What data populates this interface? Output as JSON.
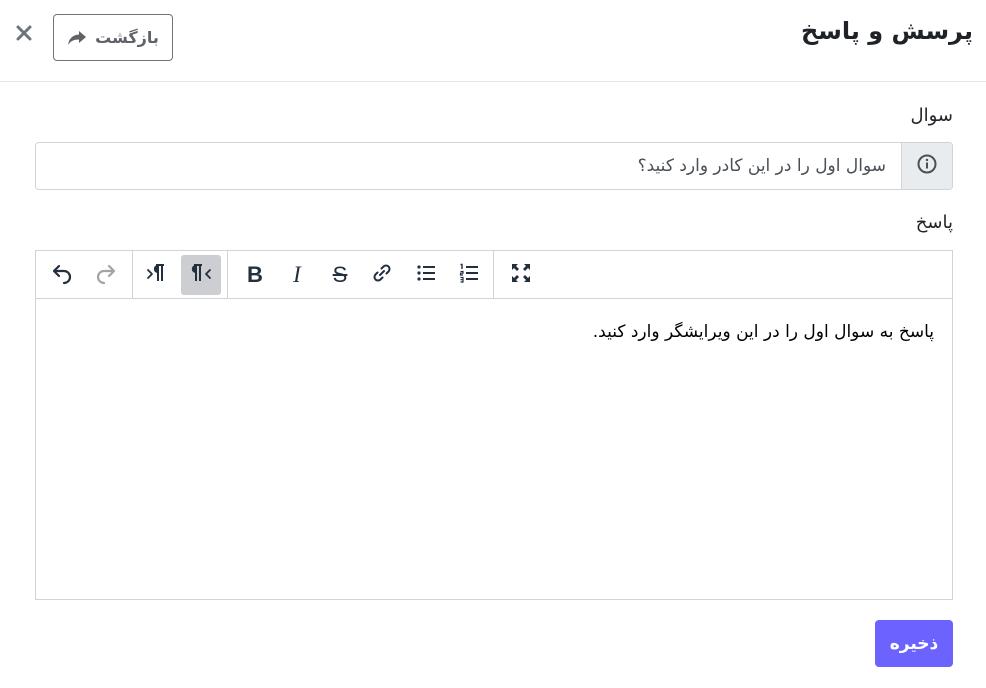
{
  "header": {
    "title": "پرسش و پاسخ",
    "back_label": "بازگشت",
    "back_icon": "share-arrow-icon",
    "close_icon": "close-icon"
  },
  "question": {
    "label": "سوال",
    "placeholder": "سوال اول را در این کادر وارد کنید؟",
    "addon_icon": "info-circle-icon"
  },
  "answer": {
    "label": "پاسخ",
    "content": "پاسخ به سوال اول را در این ویرایشگر وارد کنید.",
    "toolbar": {
      "undo_icon": "undo-icon",
      "redo_icon": "redo-icon",
      "ltr_icon": "paragraph-ltr-icon",
      "rtl_icon": "paragraph-rtl-icon",
      "bold_label": "B",
      "italic_label": "I",
      "strike_label": "S",
      "link_icon": "link-icon",
      "bullet_list_icon": "bullet-list-icon",
      "numbered_list_icon": "numbered-list-icon",
      "fullscreen_icon": "fullscreen-icon"
    }
  },
  "save_label": "ذخیره",
  "colors": {
    "primary": "#6c63ff",
    "border": "#ced4da",
    "addon_bg": "#e9ecef",
    "active_tool": "#ccced1"
  }
}
